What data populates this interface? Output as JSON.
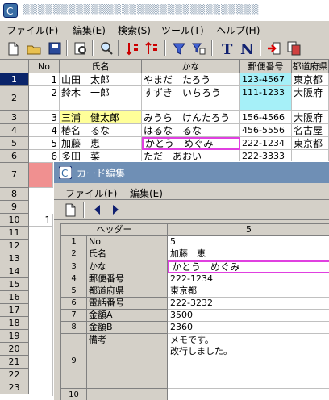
{
  "menu": [
    "ファイル(F)",
    "編集(E)",
    "検索(S)",
    "ツール(T)",
    "ヘルプ(H)"
  ],
  "toolbar": [
    "new-icon",
    "open-icon",
    "save-icon",
    "print-preview-icon",
    "search-icon",
    "sort-ascending-icon",
    "sort-descending-icon",
    "filter-icon",
    "filter-settings-icon",
    "text-icon",
    "number-icon",
    "import-icon",
    "copy-icon"
  ],
  "grid": {
    "headers": [
      "No",
      "氏名",
      "かな",
      "郵便番号",
      "都道府県"
    ],
    "row_numbers": [
      "1",
      "2",
      "3",
      "4",
      "5",
      "6",
      "7",
      "8",
      "9",
      "10",
      "11",
      "12",
      "13",
      "14",
      "15",
      "16",
      "17",
      "18",
      "19",
      "20",
      "21",
      "22",
      "23"
    ],
    "rows": [
      {
        "no": "1",
        "name": "山田　太郎",
        "kana": "やまだ　たろう",
        "zip": "123-4567",
        "pref": "東京都"
      },
      {
        "no": "2",
        "name": "鈴木　一郎",
        "kana": "すずき　いちろう",
        "zip": "111-1233",
        "pref": "大阪府"
      },
      {
        "no": "3",
        "name": "三浦　健太郎",
        "kana": "みうら　けんたろう",
        "zip": "156-4566",
        "pref": "大阪府"
      },
      {
        "no": "4",
        "name": "椿名　るな",
        "kana": "はるな　るな",
        "zip": "456-5556",
        "pref": "名古屋"
      },
      {
        "no": "5",
        "name": "加藤　恵",
        "kana": "かとう　めぐみ",
        "zip": "222-1234",
        "pref": "東京都"
      },
      {
        "no": "6",
        "name": "多田　菜",
        "kana": "ただ　あおい",
        "zip": "222-3333",
        "pref": ""
      }
    ],
    "partial_no_row10": "1"
  },
  "card": {
    "title": "カード編集",
    "menu": [
      "ファイル(F)",
      "編集(E)"
    ],
    "toolbar": [
      "new-icon",
      "prev-icon",
      "next-icon"
    ],
    "header_label": "ヘッダー",
    "header_value": "5",
    "fields": [
      {
        "num": "1",
        "label": "No",
        "value": "5"
      },
      {
        "num": "2",
        "label": "氏名",
        "value": "加藤　恵"
      },
      {
        "num": "3",
        "label": "かな",
        "value": "かとう　めぐみ"
      },
      {
        "num": "4",
        "label": "郵便番号",
        "value": "222-1234"
      },
      {
        "num": "5",
        "label": "都道府県",
        "value": "東京都"
      },
      {
        "num": "6",
        "label": "電話番号",
        "value": "222-3232"
      },
      {
        "num": "7",
        "label": "金額A",
        "value": "3500"
      },
      {
        "num": "8",
        "label": "金額B",
        "value": "2360"
      },
      {
        "num": "9",
        "label": "備考",
        "value": "メモです。",
        "value2": "改行しました。"
      },
      {
        "num": "10",
        "label": "",
        "value": ""
      }
    ]
  },
  "colors": {
    "selected_row": "#0a246a",
    "yellow_cell": "#ffff99",
    "cyan_cell": "#a6f0f8",
    "pink_row": "#f09090",
    "magenta_edit": "#e040e0"
  }
}
